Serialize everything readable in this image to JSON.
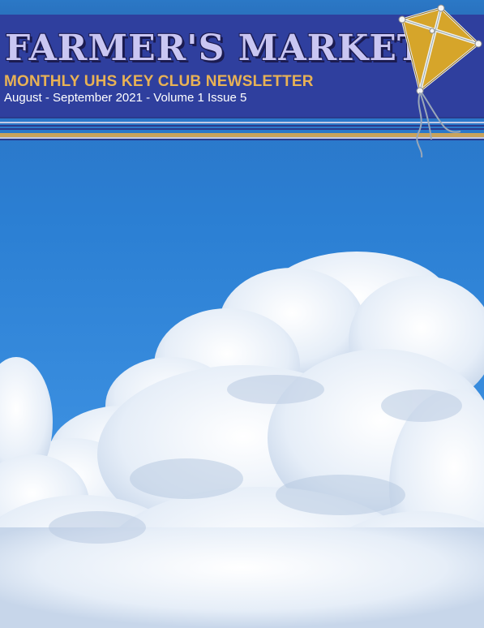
{
  "newsletter": {
    "title": "FARMER'S MARKET",
    "subtitle": "MONTHLY UHS KEY CLUB NEWSLETTER",
    "issue_line": "August - September 2021 - Volume 1 Issue 5"
  },
  "colors": {
    "header_band": "#2f3f9e",
    "title_fill": "#c9c6f2",
    "title_shadow": "#1b1b50",
    "subtitle": "#e8b255",
    "stripe_gold": "#c9a35c",
    "stripe_light": "#c2c9e6",
    "kite_yellow": "#d6a52a"
  },
  "icons": {
    "kite": "kite-icon"
  }
}
